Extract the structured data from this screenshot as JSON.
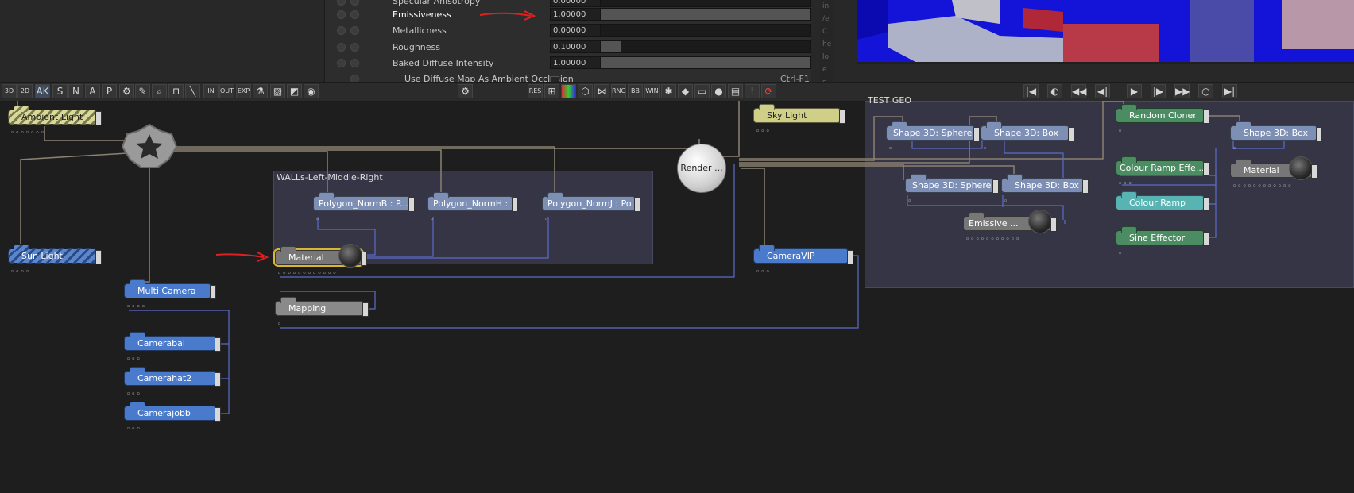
{
  "properties": {
    "rows": [
      {
        "label": "Specular Anisotropy",
        "value": "0.00000",
        "fill": 0.0
      },
      {
        "label": "Emissiveness",
        "value": "1.00000",
        "fill": 1.0,
        "highlight": true
      },
      {
        "label": "Metallicness",
        "value": "0.00000",
        "fill": 0.0
      },
      {
        "label": "Roughness",
        "value": "0.10000",
        "fill": 0.1
      },
      {
        "label": "Baked Diffuse Intensity",
        "value": "1.00000",
        "fill": 1.0
      }
    ],
    "checkbox_row": {
      "label": "Use Diffuse Map As Ambient Occlusion",
      "shortcut": "Ctrl-F1"
    }
  },
  "side_tabs": [
    "in",
    "/e",
    "C",
    "he",
    "lo",
    "e",
    "s"
  ],
  "annotation_color": "#e02020",
  "toolbar": {
    "left": [
      "3D",
      "2D",
      "AK",
      "S",
      "N",
      "A",
      "P",
      "gear",
      "lasso",
      "zoom",
      "pulse",
      "line",
      "IN",
      "OUT",
      "EXP",
      "flask",
      "stripe",
      "slash",
      "target"
    ],
    "middle": [
      "gear"
    ],
    "center": [
      "RES",
      "grid",
      "rgb",
      "cube",
      "mesh",
      "RNG",
      "BB",
      "WIN",
      "star",
      "cube2",
      "mask",
      "sphere",
      "film",
      "warn",
      "reload"
    ],
    "transport": [
      "|◀",
      "◐",
      "◀◀",
      "◀|",
      "▶",
      "|▶",
      "▶▶",
      "○",
      "▶|"
    ]
  },
  "groups": {
    "walls": {
      "title": "WALLs-Left-Middle-Right"
    },
    "test_geo": {
      "title": "TEST GEO"
    }
  },
  "nodes": {
    "ambient_light": {
      "label": "Ambient Light"
    },
    "sun_light": {
      "label": "Sun Light"
    },
    "polygon_b": {
      "label": "Polygon_NormB : P..."
    },
    "polygon_h": {
      "label": "Polygon_NormH : ..."
    },
    "polygon_j": {
      "label": "Polygon_NormJ : Po..."
    },
    "material_main": {
      "label": "Material"
    },
    "mapping": {
      "label": "Mapping"
    },
    "multi_camera": {
      "label": "Multi Camera"
    },
    "camera_a": {
      "label": "Camerabal"
    },
    "camera_b": {
      "label": "Camerahat2"
    },
    "camera_c": {
      "label": "Camerajobb"
    },
    "render": {
      "label": "Render ..."
    },
    "sky_light": {
      "label": "Sky Light"
    },
    "camera_vip": {
      "label": "CameraVIP"
    },
    "shape_sphere_1": {
      "label": "Shape 3D: Sphere"
    },
    "shape_box_1": {
      "label": "Shape 3D: Box"
    },
    "shape_sphere_2": {
      "label": "Shape 3D: Sphere"
    },
    "shape_box_2": {
      "label": "Shape 3D: Box"
    },
    "emissive": {
      "label": "Emissive ..."
    },
    "random_cloner": {
      "label": "Random Cloner"
    },
    "colour_ramp_effector": {
      "label": "Colour Ramp Effe..."
    },
    "colour_ramp": {
      "label": "Colour Ramp"
    },
    "sine_effector": {
      "label": "Sine Effector"
    },
    "shape_box_3": {
      "label": "Shape 3D: Box"
    },
    "material_geo": {
      "label": "Material"
    }
  }
}
